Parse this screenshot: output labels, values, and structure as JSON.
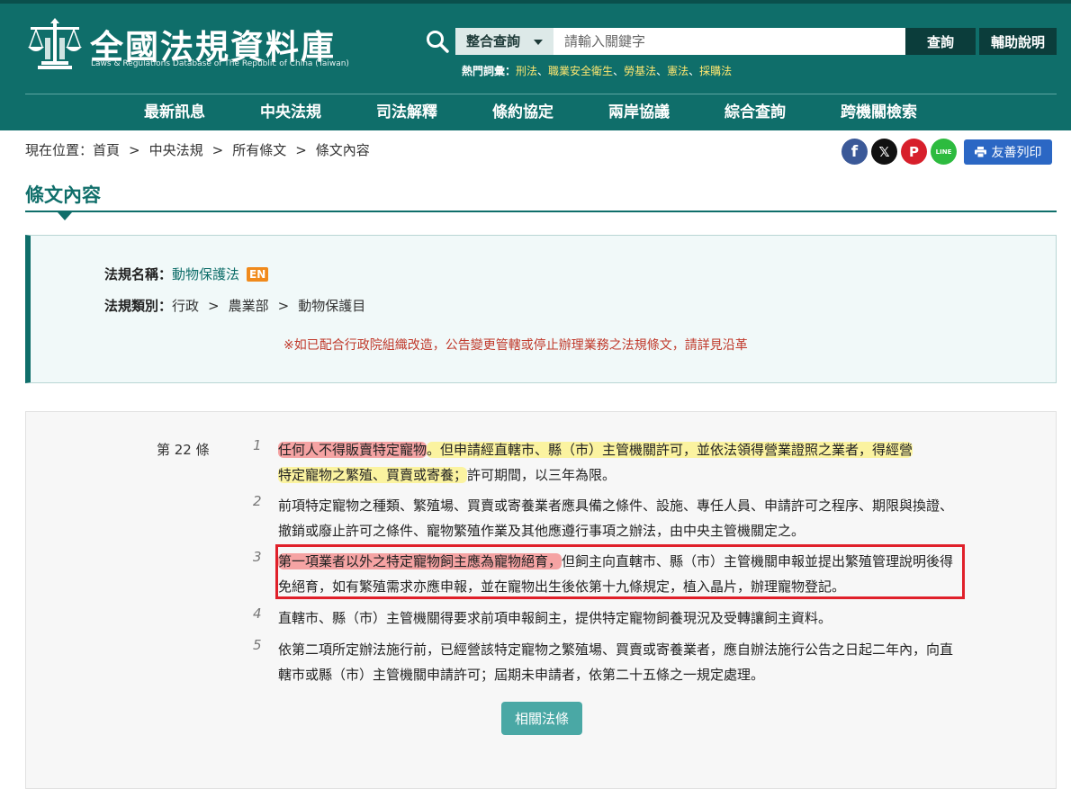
{
  "header": {
    "site_title": "全國法規資料庫",
    "site_subtitle": "Laws & Regulations Database of The Republic of China (Taiwan)",
    "search": {
      "scope_label": "整合查詢",
      "placeholder": "請輸入關鍵字",
      "query_label": "查詢",
      "help_label": "輔助說明"
    },
    "hot_words": {
      "label": "熱門詞彙：",
      "items": [
        "刑法",
        "職業安全衛生",
        "勞基法",
        "憲法",
        "採購法"
      ]
    },
    "nav": [
      "最新訊息",
      "中央法規",
      "司法解釋",
      "條約協定",
      "兩岸協議",
      "綜合查詢",
      "跨機關檢索"
    ]
  },
  "breadcrumb": {
    "prefix": "現在位置：",
    "items": [
      "首頁",
      "中央法規",
      "所有條文",
      "條文內容"
    ]
  },
  "share": {
    "facebook": "f",
    "x": "𝕏",
    "plurk": "P",
    "line": "LINE",
    "print_label": "友善列印"
  },
  "page_title": "條文內容",
  "law_info": {
    "name_key": "法規名稱：",
    "name_value": "動物保護法",
    "en_badge": "EN",
    "category_key": "法規類別：",
    "category_path": [
      "行政",
      "農業部",
      "動物保護目"
    ],
    "notice": "※如已配合行政院組織改造，公告變更管轄或停止辦理業務之法規條文，請詳見沿革"
  },
  "article": {
    "number": "第 22 條",
    "paragraphs": [
      {
        "num": "1",
        "red": "任何人不得販賣特定寵物",
        "yellow1": "。但申請經直轄市、縣（市）主管機關許可，並依法領得營業證照之業者，得經營",
        "yellow2": "特定寵物之繁殖、買賣或寄養；",
        "rest": "許可期間，以三年為限。"
      },
      {
        "num": "2",
        "text": "前項特定寵物之種類、繁殖場、買賣或寄養業者應具備之條件、設施、專任人員、申請許可之程序、期限與換證、撤銷或廢止許可之條件、寵物繁殖作業及其他應遵行事項之辦法，由中央主管機關定之。"
      },
      {
        "num": "3",
        "red": "第一項業者以外之特定寵物飼主應為寵物絕育，",
        "rest": "但飼主向直轄市、縣（市）主管機關申報並提出繁殖管理說明後得免絕育，如有繁殖需求亦應申報，並在寵物出生後依第十九條規定，植入晶片，辦理寵物登記。"
      },
      {
        "num": "4",
        "text": "直轄市、縣（市）主管機關得要求前項申報飼主，提供特定寵物飼養現況及受轉讓飼主資料。"
      },
      {
        "num": "5",
        "text": "依第二項所定辦法施行前，已經營該特定寵物之繁殖場、買賣或寄養業者，應自辦法施行公告之日起二年內，向直轄市或縣（市）主管機關申請許可；屆期未申請者，依第二十五條之一規定處理。"
      }
    ],
    "related_label": "相關法條"
  }
}
